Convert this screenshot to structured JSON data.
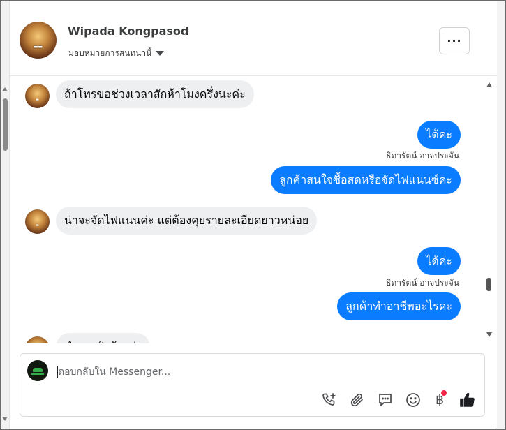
{
  "header": {
    "contact_name": "Wipada Kongpasod",
    "assign_label": "มอบหมายการสนทนานี้",
    "more_label": "···"
  },
  "messages": [
    {
      "direction": "in",
      "text": "ถ้าโทรขอช่วงเวลาสักห้าโมงครึ่งนะค่ะ"
    },
    {
      "direction": "out",
      "text": "ได้ค่ะ"
    },
    {
      "direction": "out",
      "sender": "ธิดารัตน์ อาจประจัน",
      "text": "ลูกค้าสนใจซื้อสดหรือจัดไฟแนนซ์คะ"
    },
    {
      "direction": "in",
      "text": "น่าจะจัดไฟแนนค่ะ แต่ต้องคุยรายละเอียดยาวหน่อย"
    },
    {
      "direction": "out",
      "text": "ได้ค่ะ"
    },
    {
      "direction": "out",
      "sender": "ธิดารัตน์ อาจประจัน",
      "text": "ลูกค้าทำอาชีพอะไรคะ"
    },
    {
      "direction": "in",
      "text": "ทำงานรับจ้างค่ะ"
    }
  ],
  "composer": {
    "placeholder": "ตอบกลับใน Messenger...",
    "tool_icons": [
      "phone-plus-icon",
      "paperclip-icon",
      "saved-reply-icon",
      "emoji-icon",
      "baht-icon",
      "thumbs-up-icon"
    ]
  },
  "colors": {
    "outgoing_bubble": "#0a7cff",
    "incoming_bubble": "#eeeff1",
    "notification_dot": "#f02849"
  }
}
